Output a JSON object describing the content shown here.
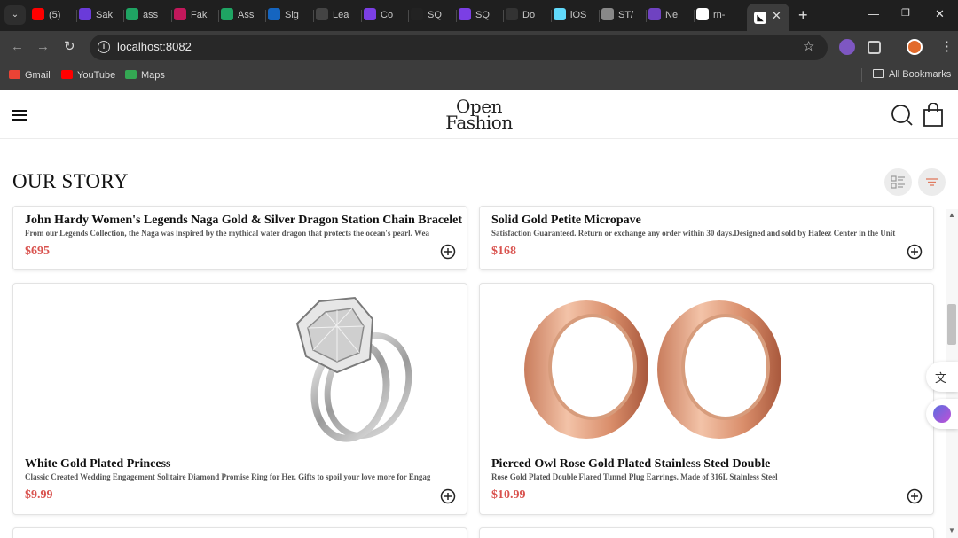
{
  "browser": {
    "tabs": [
      {
        "label": "(5)",
        "icon": "youtube-icon",
        "color": "#ff0000"
      },
      {
        "label": "Sak",
        "icon": "app-icon",
        "color": "#6a3bd9"
      },
      {
        "label": "ass",
        "icon": "drive-icon",
        "color": "#1fa463"
      },
      {
        "label": "Fak",
        "icon": "app-icon",
        "color": "#c2185b"
      },
      {
        "label": "Ass",
        "icon": "drive-icon",
        "color": "#1fa463"
      },
      {
        "label": "Sig",
        "icon": "app-icon",
        "color": "#1565c0"
      },
      {
        "label": "Lea",
        "icon": "app-icon",
        "color": "#444444"
      },
      {
        "label": "Co",
        "icon": "app-icon",
        "color": "#7b3fe4"
      },
      {
        "label": "SQ",
        "icon": "app-icon",
        "color": "#222222"
      },
      {
        "label": "SQ",
        "icon": "app-icon",
        "color": "#7b3fe4"
      },
      {
        "label": "Do",
        "icon": "app-icon",
        "color": "#333333"
      },
      {
        "label": "iOS",
        "icon": "react-icon",
        "color": "#61dafb"
      },
      {
        "label": "ST/",
        "icon": "globe-icon",
        "color": "#888888"
      },
      {
        "label": "Ne",
        "icon": "app-icon",
        "color": "#6f42c1"
      },
      {
        "label": "rn-",
        "icon": "github-icon",
        "color": "#ffffff"
      }
    ],
    "active_tab_icon": "expo-icon",
    "url": "localhost:8082",
    "bookmarks": [
      {
        "label": "Gmail",
        "color": "#ea4335"
      },
      {
        "label": "YouTube",
        "color": "#ff0000"
      },
      {
        "label": "Maps",
        "color": "#34a853"
      }
    ],
    "all_bookmarks": "All Bookmarks"
  },
  "header": {
    "logo_line1": "Open",
    "logo_line2": "Fashion"
  },
  "section_title": "OUR STORY",
  "products": [
    {
      "title": "John Hardy Women's Legends Naga Gold & Silver Dragon Station Chain Bracelet",
      "description": "From our Legends Collection, the Naga was inspired by the mythical water dragon that protects the ocean's pearl. Wea",
      "price": "$695"
    },
    {
      "title": "Solid Gold Petite Micropave",
      "description": "Satisfaction Guaranteed. Return or exchange any order within 30 days.Designed and sold by Hafeez Center in the Unit",
      "price": "$168"
    },
    {
      "title": "White Gold Plated Princess",
      "description": "Classic Created Wedding Engagement Solitaire Diamond Promise Ring for Her. Gifts to spoil your love more for Engag",
      "price": "$9.99"
    },
    {
      "title": "Pierced Owl Rose Gold Plated Stainless Steel Double",
      "description": "Rose Gold Plated Double Flared Tunnel Plug Earrings. Made of 316L Stainless Steel",
      "price": "$10.99"
    }
  ],
  "colors": {
    "price": "#d9534f",
    "chrome_dark": "#1f1f1f",
    "chrome": "#3c3c3c"
  }
}
